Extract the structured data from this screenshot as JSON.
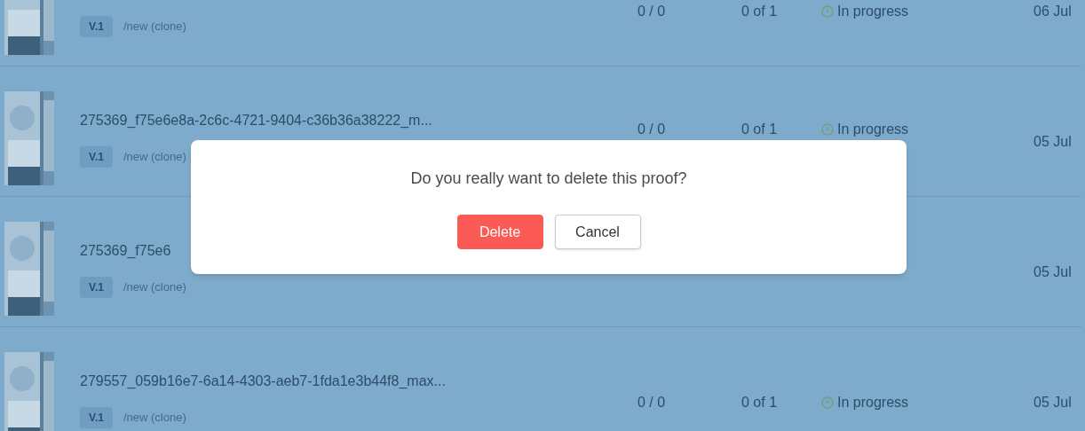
{
  "rows": [
    {
      "version": "V.1",
      "branch": "/new (clone)",
      "count": "0 / 0",
      "review": "0 of 1",
      "status": "In progress",
      "date": "06 Jul"
    },
    {
      "title": "275369_f75e6e8a-2c6c-4721-9404-c36b36a38222_m...",
      "version": "V.1",
      "branch": "/new (clone)",
      "count": "0 / 0",
      "review": "0 of 1",
      "status": "In progress",
      "date": "05 Jul"
    },
    {
      "title": "275369_f75e6",
      "version": "V.1",
      "branch": "/new (clone)",
      "date": "05 Jul"
    },
    {
      "title": "279557_059b16e7-6a14-4303-aeb7-1fda1e3b44f8_max...",
      "version": "V.1",
      "branch": "/new (clone)",
      "count": "0 / 0",
      "review": "0 of 1",
      "status": "In progress",
      "date": "05 Jul"
    }
  ],
  "dialog": {
    "message": "Do you really want to delete this proof?",
    "buttons": [
      {
        "label": "Delete",
        "kind": "danger"
      },
      {
        "label": "Cancel",
        "kind": "default"
      }
    ]
  }
}
